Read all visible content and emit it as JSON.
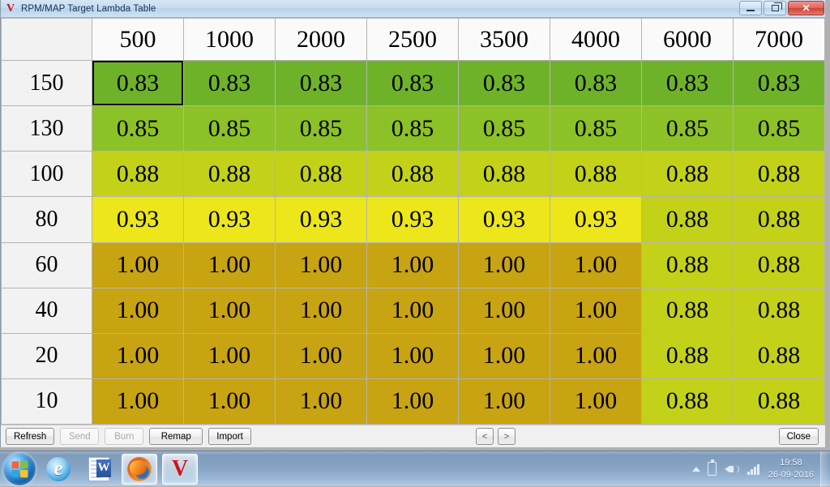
{
  "window": {
    "title": "RPM/MAP Target Lambda Table",
    "icon": "v-logo-icon",
    "controls": {
      "minimize": "minimize-button",
      "restore": "restore-button",
      "close_glyph": "✕"
    }
  },
  "table": {
    "corner_label": "",
    "column_headers": [
      "500",
      "1000",
      "2000",
      "2500",
      "3500",
      "4000",
      "6000",
      "7000"
    ],
    "row_headers": [
      "150",
      "130",
      "100",
      "80",
      "60",
      "40",
      "20",
      "10"
    ],
    "selected_cell": {
      "row": 0,
      "col": 0
    },
    "rows": [
      {
        "header": "150",
        "values": [
          "0.83",
          "0.83",
          "0.83",
          "0.83",
          "0.83",
          "0.83",
          "0.83",
          "0.83"
        ],
        "colors": [
          "#6eb22a",
          "#6eb22a",
          "#6eb22a",
          "#6eb22a",
          "#6eb22a",
          "#6eb22a",
          "#6eb22a",
          "#6eb22a"
        ]
      },
      {
        "header": "130",
        "values": [
          "0.85",
          "0.85",
          "0.85",
          "0.85",
          "0.85",
          "0.85",
          "0.85",
          "0.85"
        ],
        "colors": [
          "#8cc127",
          "#8cc127",
          "#8cc127",
          "#8cc127",
          "#8cc127",
          "#8cc127",
          "#8cc127",
          "#8cc127"
        ]
      },
      {
        "header": "100",
        "values": [
          "0.88",
          "0.88",
          "0.88",
          "0.88",
          "0.88",
          "0.88",
          "0.88",
          "0.88"
        ],
        "colors": [
          "#c3d118",
          "#c3d118",
          "#c3d118",
          "#c3d118",
          "#c3d118",
          "#c3d118",
          "#c3d118",
          "#c3d118"
        ]
      },
      {
        "header": "80",
        "values": [
          "0.93",
          "0.93",
          "0.93",
          "0.93",
          "0.93",
          "0.93",
          "0.88",
          "0.88"
        ],
        "colors": [
          "#ece61a",
          "#ece61a",
          "#ece61a",
          "#ece61a",
          "#ece61a",
          "#ece61a",
          "#c3d118",
          "#c3d118"
        ]
      },
      {
        "header": "60",
        "values": [
          "1.00",
          "1.00",
          "1.00",
          "1.00",
          "1.00",
          "1.00",
          "0.88",
          "0.88"
        ],
        "colors": [
          "#c8a312",
          "#c8a312",
          "#c8a312",
          "#c8a312",
          "#c8a312",
          "#c8a312",
          "#c3d118",
          "#c3d118"
        ]
      },
      {
        "header": "40",
        "values": [
          "1.00",
          "1.00",
          "1.00",
          "1.00",
          "1.00",
          "1.00",
          "0.88",
          "0.88"
        ],
        "colors": [
          "#c8a312",
          "#c8a312",
          "#c8a312",
          "#c8a312",
          "#c8a312",
          "#c8a312",
          "#c3d118",
          "#c3d118"
        ]
      },
      {
        "header": "20",
        "values": [
          "1.00",
          "1.00",
          "1.00",
          "1.00",
          "1.00",
          "1.00",
          "0.88",
          "0.88"
        ],
        "colors": [
          "#c8a312",
          "#c8a312",
          "#c8a312",
          "#c8a312",
          "#c8a312",
          "#c8a312",
          "#c3d118",
          "#c3d118"
        ]
      },
      {
        "header": "10",
        "values": [
          "1.00",
          "1.00",
          "1.00",
          "1.00",
          "1.00",
          "1.00",
          "0.88",
          "0.88"
        ],
        "colors": [
          "#c8a312",
          "#c8a312",
          "#c8a312",
          "#c8a312",
          "#c8a312",
          "#c8a312",
          "#c3d118",
          "#c3d118"
        ]
      }
    ]
  },
  "buttons": {
    "refresh": "Refresh",
    "send": "Send",
    "burn": "Burn",
    "remap": "Remap",
    "import": "Import",
    "prev": "<",
    "next": ">",
    "close": "Close",
    "disabled": [
      "Send",
      "Burn"
    ]
  },
  "taskbar": {
    "start": "start-orb",
    "items": [
      {
        "name": "internet-explorer",
        "active": false
      },
      {
        "name": "microsoft-word",
        "letter": "W",
        "active": false
      },
      {
        "name": "firefox",
        "active": true
      },
      {
        "name": "v-app",
        "letter": "V",
        "active": true
      }
    ],
    "tray": {
      "time": "19:58",
      "date": "26-09-2016",
      "icons": [
        "show-hidden-icons-arrow",
        "battery-icon",
        "volume-icon",
        "network-signal-icon"
      ]
    }
  }
}
